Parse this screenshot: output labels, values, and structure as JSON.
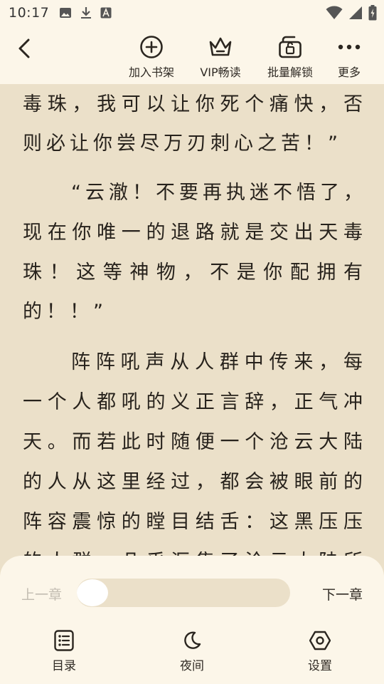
{
  "status_bar": {
    "time": "10:17",
    "left_icons": [
      "image-icon",
      "download-icon",
      "text-a-icon"
    ],
    "right_icons": [
      "wifi-icon",
      "signal-icon",
      "battery-charging-icon"
    ]
  },
  "toolbar": {
    "back_icon": "chevron-left-icon",
    "items": [
      {
        "label": "加入书架",
        "icon": "plus-circle-icon"
      },
      {
        "label": "VIP畅读",
        "icon": "crown-icon"
      },
      {
        "label": "批量解锁",
        "icon": "unlock-icon"
      },
      {
        "label": "更多",
        "icon": "more-dots-icon"
      }
    ]
  },
  "content": {
    "lines": [
      {
        "text": "毒珠，我可以让你死个痛快，否"
      },
      {
        "text": "则必让你尝尽万刃刺心之苦！”"
      },
      {
        "text": "“云澈！不要再执迷不悟了，"
      },
      {
        "text": "现在你唯一的退路就是交出天毒"
      },
      {
        "text": "珠！这等神物，不是你配拥有"
      },
      {
        "text": "的！！”"
      },
      {
        "text": "阵阵吼声从人群中传来，每"
      },
      {
        "text": "一个人都吼的义正言辞，正气冲"
      },
      {
        "text": "天。而若此时随便一个沧云大陆"
      },
      {
        "text": "的人从这里经过，都会被眼前的"
      },
      {
        "text": "阵容震惊的瞠目结舌：这黑压压"
      },
      {
        "text": "的人群，几乎汇集了沧云大陆所"
      }
    ]
  },
  "bottom_panel": {
    "prev_chapter": "上一章",
    "next_chapter": "下一章",
    "progress": 0.0,
    "buttons": [
      {
        "label": "目录",
        "icon": "catalog-list-icon"
      },
      {
        "label": "夜间",
        "icon": "moon-icon"
      },
      {
        "label": "设置",
        "icon": "settings-hexagon-icon"
      }
    ]
  },
  "colors": {
    "page_background": "#ebe0c9",
    "panel_background": "#fcf6e9",
    "text": "#27221c",
    "muted_text": "#c2bcb1"
  }
}
